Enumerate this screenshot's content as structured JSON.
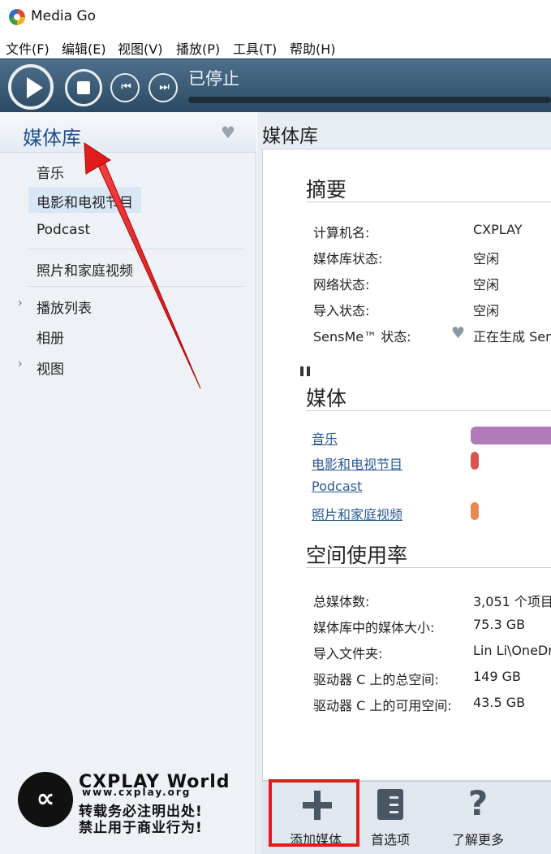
{
  "window": {
    "title": "Media Go"
  },
  "menu": [
    "文件(F)",
    "编辑(E)",
    "视图(V)",
    "播放(P)",
    "工具(T)",
    "帮助(H)"
  ],
  "player": {
    "status": "已停止",
    "skip_prev_glyph": "⏮",
    "skip_next_glyph": "⏭"
  },
  "sidebar": {
    "header": "媒体库",
    "items": {
      "music": "音乐",
      "movies": "电影和电视节目",
      "podcast": "Podcast",
      "photos": "照片和家庭视频",
      "playlists": "播放列表",
      "albums": "相册",
      "views": "视图"
    },
    "heart_glyph": "♥",
    "expander_glyph": "›"
  },
  "watermark": {
    "logo_glyph": "∝",
    "brand": "CXPLAY World",
    "url": "www.cxplay.org",
    "line1": "转载务必注明出处!",
    "line2": "禁止用于商业行为!"
  },
  "main": {
    "title": "媒体库",
    "summary": {
      "title": "摘要",
      "rows": [
        {
          "label": "计算机名:",
          "value": "CXPLAY"
        },
        {
          "label": "媒体库状态:",
          "value": "空闲"
        },
        {
          "label": "网络状态:",
          "value": "空闲"
        },
        {
          "label": "导入状态:",
          "value": "空闲"
        },
        {
          "label": "SensMe™ 状态:",
          "value": "正在生成 SensMe"
        }
      ],
      "pause_glyph": "❚❚",
      "sensme_glyph": "♥"
    },
    "media": {
      "title": "媒体",
      "links": [
        "音乐",
        "电影和电视节目",
        "Podcast",
        "照片和家庭视频"
      ],
      "bar_colors": [
        "#b07cb8",
        "#d9534f",
        "#e8894e"
      ],
      "bar_levels": [
        1.0,
        0.08,
        0.08
      ]
    },
    "space": {
      "title": "空间使用率",
      "rows": [
        {
          "label": "总媒体数:",
          "value": "3,051 个项目"
        },
        {
          "label": "媒体库中的媒体大小:",
          "value": "75.3 GB"
        },
        {
          "label": "导入文件夹:",
          "value": "Lin Li\\OneDrive"
        },
        {
          "label": "驱动器 C 上的总空间:",
          "value": "149 GB"
        },
        {
          "label": "驱动器 C 上的可用空间:",
          "value": "43.5 GB"
        }
      ]
    }
  },
  "toolbar": {
    "add_media": "添加媒体",
    "preferences": "首选项",
    "learn_more": "了解更多",
    "help_glyph": "?"
  },
  "colors": {
    "annotation": "#e21b1b",
    "player_bg": "#3a5874",
    "link": "#2b5a96"
  }
}
